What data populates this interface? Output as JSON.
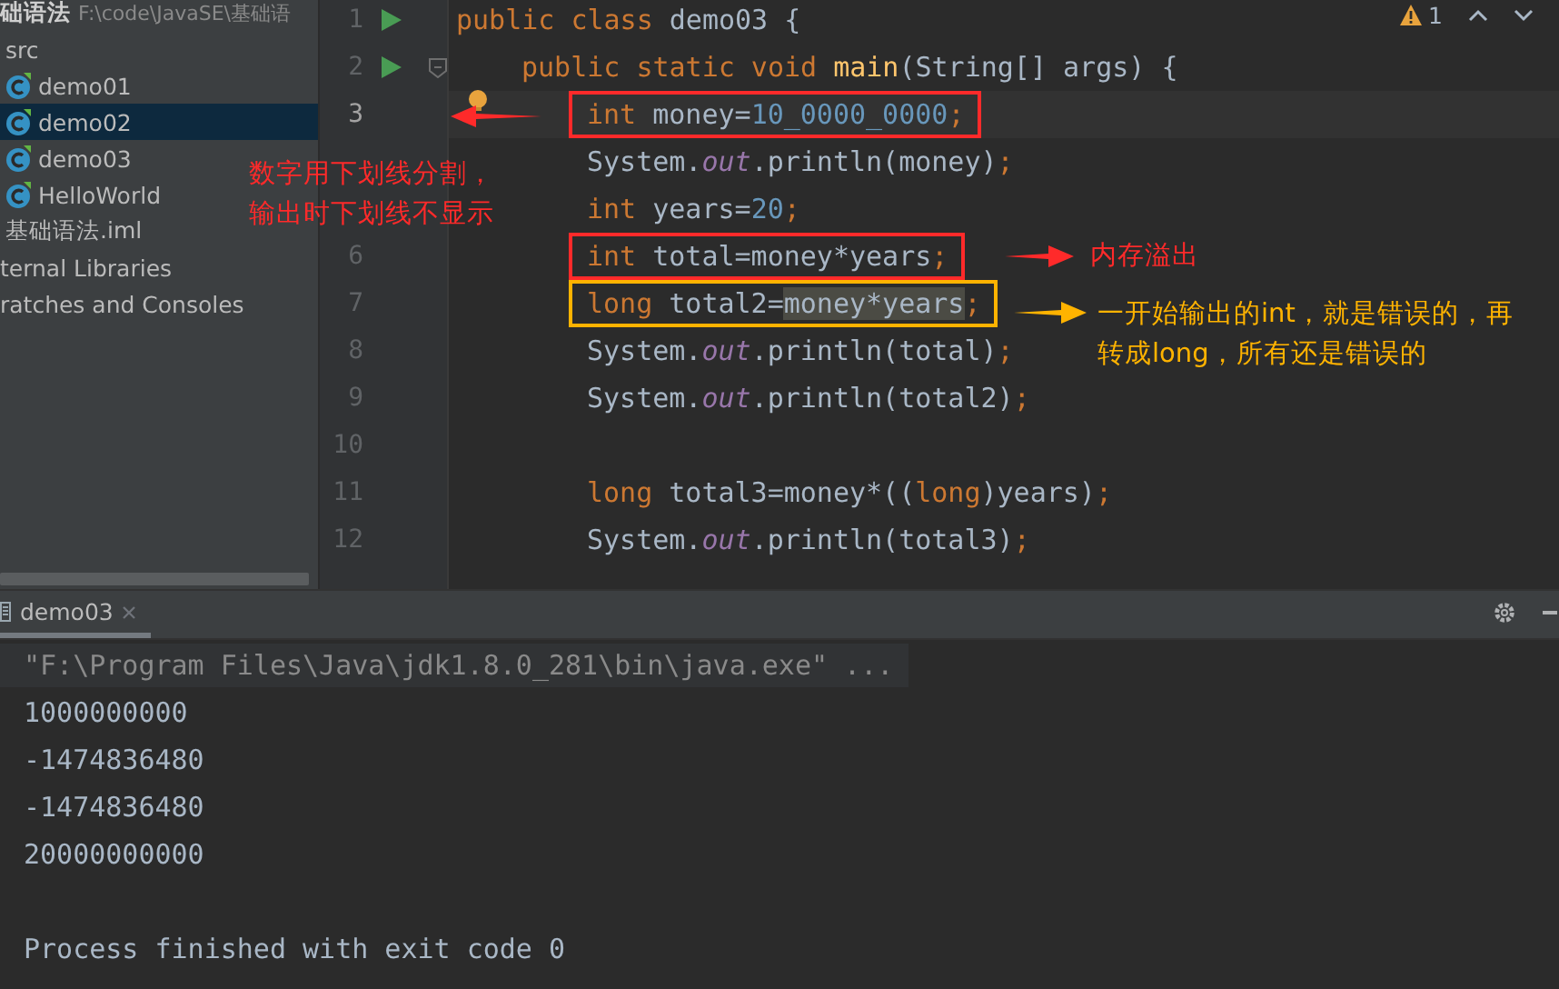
{
  "project_tree": [
    {
      "label": "础语法",
      "path": "F:\\code\\JavaSE\\基础语",
      "kind": "module",
      "selected": false,
      "children": [
        {
          "label": "src",
          "kind": "item",
          "selected": false,
          "children": [
            {
              "label": "demo01",
              "kind": "class",
              "selected": false
            },
            {
              "label": "demo02",
              "kind": "class",
              "selected": true
            },
            {
              "label": "demo03",
              "kind": "class",
              "selected": false
            },
            {
              "label": "HelloWorld",
              "kind": "class",
              "selected": false
            }
          ]
        },
        {
          "label": "基础语法.iml",
          "kind": "item",
          "selected": false
        }
      ]
    },
    {
      "label": "ternal Libraries",
      "kind": "item",
      "selected": false
    },
    {
      "label": "ratches and Consoles",
      "kind": "item",
      "selected": false
    }
  ],
  "editor": {
    "problems": {
      "count": "1"
    },
    "lines": [
      {
        "number": "1",
        "current": false,
        "runnable": true,
        "foldable": false,
        "intention": false,
        "tokens": [
          {
            "kind": "keyword",
            "text": "public class "
          },
          {
            "kind": "plain",
            "text": "demo03 {"
          }
        ],
        "children": [
          {
            "number": "2",
            "current": false,
            "runnable": true,
            "foldable": true,
            "intention": false,
            "tokens": [
              {
                "kind": "keyword",
                "text": "public static void "
              },
              {
                "kind": "method",
                "text": "main"
              },
              {
                "kind": "plain",
                "text": "(String[] args) {"
              }
            ],
            "children": [
              {
                "number": "3",
                "current": true,
                "runnable": false,
                "foldable": false,
                "intention": true,
                "color": "#ff2a2a",
                "tokens": [
                  {
                    "kind": "keyword",
                    "text": "int "
                  },
                  {
                    "kind": "plain",
                    "text": "money="
                  },
                  {
                    "kind": "number",
                    "text": "10_0000_0000"
                  },
                  {
                    "kind": "keyword",
                    "text": ";"
                  }
                ]
              },
              {
                "current": false,
                "runnable": false,
                "foldable": false,
                "intention": false,
                "tokens": [
                  {
                    "kind": "plain",
                    "text": "System."
                  },
                  {
                    "kind": "field",
                    "text": "out"
                  },
                  {
                    "kind": "plain",
                    "text": ".println(money)"
                  },
                  {
                    "kind": "keyword",
                    "text": ";"
                  }
                ]
              },
              {
                "current": false,
                "runnable": false,
                "foldable": false,
                "intention": false,
                "tokens": [
                  {
                    "kind": "keyword",
                    "text": "int "
                  },
                  {
                    "kind": "plain",
                    "text": "years="
                  },
                  {
                    "kind": "number",
                    "text": "20"
                  },
                  {
                    "kind": "keyword",
                    "text": ";"
                  }
                ]
              },
              {
                "number": "6",
                "current": false,
                "runnable": false,
                "foldable": false,
                "intention": false,
                "color": "#ff2a2a",
                "tokens": [
                  {
                    "kind": "keyword",
                    "text": "int "
                  },
                  {
                    "kind": "plain",
                    "text": "total=money*years"
                  },
                  {
                    "kind": "keyword",
                    "text": ";"
                  }
                ]
              },
              {
                "number": "7",
                "current": false,
                "runnable": false,
                "foldable": false,
                "intention": false,
                "color": "#ffb300",
                "tokens": [
                  {
                    "kind": "keyword",
                    "text": "long "
                  },
                  {
                    "kind": "plain",
                    "text": "total2="
                  },
                  {
                    "kind": "selection",
                    "text": "money*years"
                  },
                  {
                    "kind": "keyword",
                    "text": ";"
                  }
                ]
              },
              {
                "number": "8",
                "current": false,
                "runnable": false,
                "foldable": false,
                "intention": false,
                "tokens": [
                  {
                    "kind": "plain",
                    "text": "System."
                  },
                  {
                    "kind": "field",
                    "text": "out"
                  },
                  {
                    "kind": "plain",
                    "text": ".println(total)"
                  },
                  {
                    "kind": "keyword",
                    "text": ";"
                  }
                ]
              },
              {
                "number": "9",
                "current": false,
                "runnable": false,
                "foldable": false,
                "intention": false,
                "tokens": [
                  {
                    "kind": "plain",
                    "text": "System."
                  },
                  {
                    "kind": "field",
                    "text": "out"
                  },
                  {
                    "kind": "plain",
                    "text": ".println(total2)"
                  },
                  {
                    "kind": "keyword",
                    "text": ";"
                  }
                ]
              },
              {
                "number": "10",
                "current": false,
                "runnable": false,
                "foldable": false,
                "intention": false
              },
              {
                "number": "11",
                "current": false,
                "runnable": false,
                "foldable": false,
                "intention": false,
                "tokens": [
                  {
                    "kind": "keyword",
                    "text": "long "
                  },
                  {
                    "kind": "plain",
                    "text": "total3=money*(("
                  },
                  {
                    "kind": "keyword",
                    "text": "long"
                  },
                  {
                    "kind": "plain",
                    "text": ")years)"
                  },
                  {
                    "kind": "keyword",
                    "text": ";"
                  }
                ]
              },
              {
                "number": "12",
                "current": false,
                "runnable": false,
                "foldable": false,
                "intention": false,
                "tokens": [
                  {
                    "kind": "plain",
                    "text": "System."
                  },
                  {
                    "kind": "field",
                    "text": "out"
                  },
                  {
                    "kind": "plain",
                    "text": ".println(total3)"
                  },
                  {
                    "kind": "keyword",
                    "text": ";"
                  }
                ]
              }
            ]
          }
        ]
      }
    ]
  },
  "notes": [
    {
      "text": "数字用下划线分割，输出时下划线不显示",
      "color": "#ff2a2a"
    },
    {
      "text": "内存溢出",
      "color": "#ff2a2a"
    },
    {
      "text": "一开始输出的int，就是错误的，再转成long，所有还是错误的",
      "color": "#ffb300"
    }
  ],
  "run_panel": {
    "tabs": [
      {
        "label": "demo03",
        "selected": true
      }
    ],
    "lines": [
      {
        "kind": "command",
        "text": "\"F:\\Program Files\\Java\\jdk1.8.0_281\\bin\\java.exe\" ..."
      },
      {
        "kind": "output",
        "text": "1000000000"
      },
      {
        "kind": "output",
        "text": "-1474836480"
      },
      {
        "kind": "output",
        "text": "-1474836480"
      },
      {
        "kind": "output",
        "text": "20000000000"
      },
      {
        "kind": "status",
        "text": "Process finished with exit code 0"
      }
    ]
  }
}
